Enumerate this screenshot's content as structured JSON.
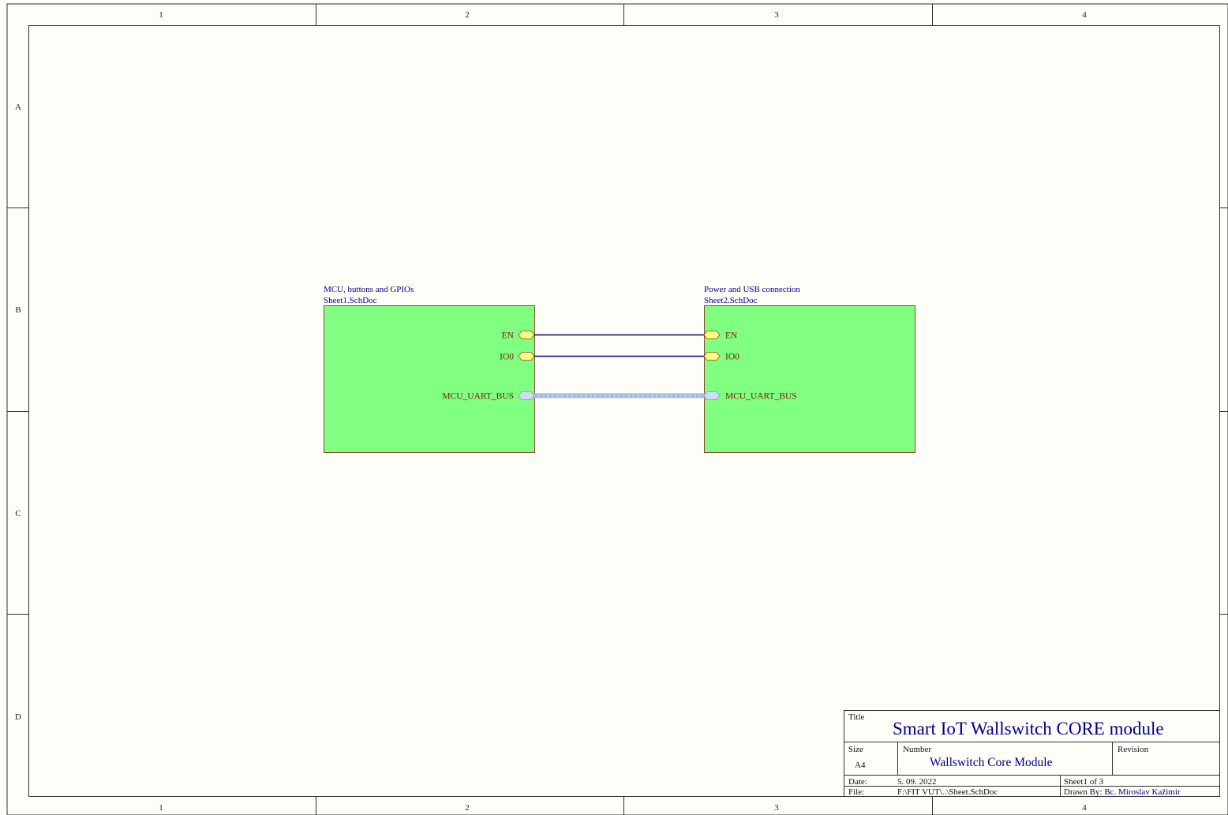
{
  "zones": {
    "columns": [
      "1",
      "2",
      "3",
      "4"
    ],
    "rows": [
      "A",
      "B",
      "C",
      "D"
    ]
  },
  "sheets": [
    {
      "name": "MCU, buttons and GPIOs",
      "file": "Sheet1.SchDoc",
      "fill": "#80ff80",
      "ports": [
        "EN",
        "IO0",
        "MCU_UART_BUS"
      ]
    },
    {
      "name": "Power and USB connection",
      "file": "Sheet2.SchDoc",
      "fill": "#80ff80",
      "ports": [
        "EN",
        "IO0",
        "MCU_UART_BUS"
      ]
    }
  ],
  "connections": [
    {
      "from": "EN",
      "to": "EN",
      "kind": "wire"
    },
    {
      "from": "IO0",
      "to": "IO0",
      "kind": "wire"
    },
    {
      "from": "MCU_UART_BUS",
      "to": "MCU_UART_BUS",
      "kind": "bus"
    }
  ],
  "title_block": {
    "title_label": "Title",
    "title": "Smart IoT Wallswitch CORE module",
    "size_label": "Size",
    "size": "A4",
    "number_label": "Number",
    "number": "Wallswitch Core Module",
    "revision_label": "Revision",
    "revision": "",
    "date_label": "Date:",
    "date": "5. 09. 2022",
    "sheet_label": "Sheet",
    "sheet_num": "1",
    "of_label": "of",
    "sheet_total": "3",
    "file_label": "File:",
    "file": "F:\\FIT VUT\\..\\Sheet.SchDoc",
    "drawn_label": "Drawn By:",
    "drawn_by": "Bc. Miroslav Kažimír"
  },
  "colors": {
    "border": "#303030",
    "wire": "#000080",
    "bus": "#9fb8e0",
    "port_fill": "#ffff80",
    "bus_port_fill": "#cfdcf5",
    "sheet_fill": "#80ff80",
    "text_blue": "#00008b",
    "port_text": "#7a1a08"
  }
}
